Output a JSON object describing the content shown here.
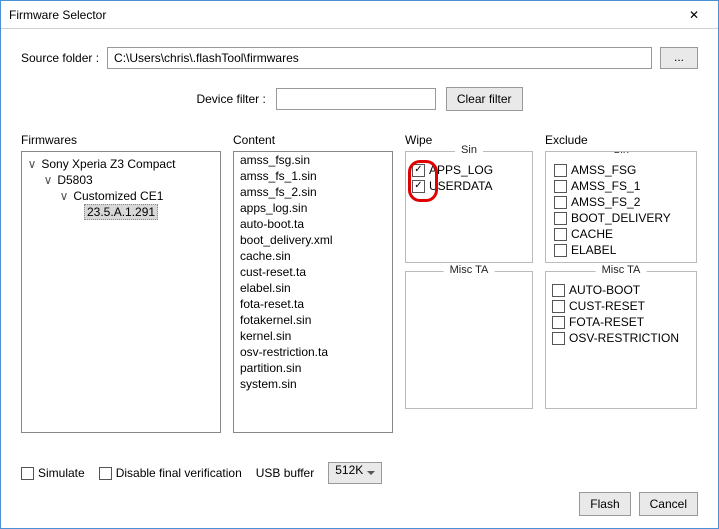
{
  "window": {
    "title": "Firmware Selector"
  },
  "source": {
    "label": "Source folder :",
    "path": "C:\\Users\\chris\\.flashTool\\firmwares",
    "browse": "..."
  },
  "filter": {
    "label": "Device filter :",
    "clear": "Clear filter"
  },
  "headers": {
    "firmwares": "Firmwares",
    "content": "Content",
    "wipe": "Wipe",
    "exclude": "Exclude",
    "sin": "Sin",
    "misc": "Misc TA"
  },
  "tree": {
    "l0": "Sony Xperia Z3 Compact",
    "l1": "D5803",
    "l2": "Customized CE1",
    "l3": "23.5.A.1.291"
  },
  "content": [
    "amss_fsg.sin",
    "amss_fs_1.sin",
    "amss_fs_2.sin",
    "apps_log.sin",
    "auto-boot.ta",
    "boot_delivery.xml",
    "cache.sin",
    "cust-reset.ta",
    "elabel.sin",
    "fota-reset.ta",
    "fotakernel.sin",
    "kernel.sin",
    "osv-restriction.ta",
    "partition.sin",
    "system.sin"
  ],
  "wipe_sin": [
    {
      "label": "APPS_LOG",
      "checked": true
    },
    {
      "label": "USERDATA",
      "checked": true
    }
  ],
  "exclude_sin": [
    {
      "label": "AMSS_FSG",
      "checked": false
    },
    {
      "label": "AMSS_FS_1",
      "checked": false
    },
    {
      "label": "AMSS_FS_2",
      "checked": false
    },
    {
      "label": "BOOT_DELIVERY",
      "checked": false
    },
    {
      "label": "CACHE",
      "checked": false
    },
    {
      "label": "ELABEL",
      "checked": false
    }
  ],
  "exclude_misc": [
    {
      "label": "AUTO-BOOT",
      "checked": false
    },
    {
      "label": "CUST-RESET",
      "checked": false
    },
    {
      "label": "FOTA-RESET",
      "checked": false
    },
    {
      "label": "OSV-RESTRICTION",
      "checked": false
    }
  ],
  "options": {
    "simulate": "Simulate",
    "disable_final": "Disable final verification",
    "usb_buffer_label": "USB buffer",
    "usb_buffer_value": "512K"
  },
  "footer": {
    "flash": "Flash",
    "cancel": "Cancel"
  }
}
